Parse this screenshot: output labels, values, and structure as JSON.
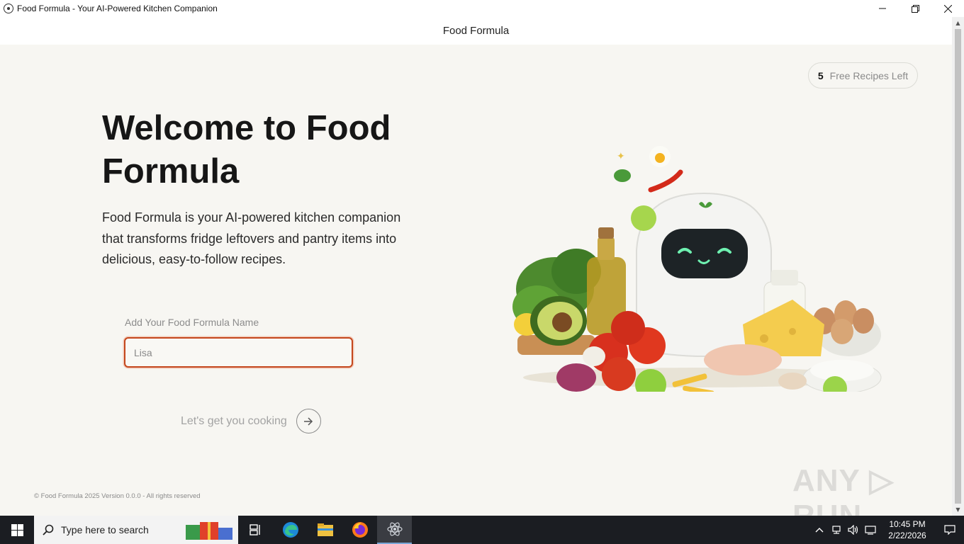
{
  "window": {
    "title": "Food Formula - Your AI-Powered Kitchen Companion",
    "minimize_icon": "minimize-icon",
    "restore_icon": "restore-icon",
    "close_icon": "close-icon"
  },
  "header": {
    "title": "Food Formula"
  },
  "badge": {
    "count": "5",
    "label": "Free Recipes Left"
  },
  "hero": {
    "title": "Welcome to Food Formula",
    "description": "Food Formula is your AI-powered kitchen companion that transforms fridge leftovers and pantry items into delicious, easy-to-follow recipes."
  },
  "form": {
    "name_label": "Add Your Food Formula Name",
    "name_placeholder": "Lisa",
    "name_value": "",
    "submit_label": "Let's get you cooking",
    "submit_icon": "arrow-right-icon"
  },
  "footer": {
    "text": "© Food Formula 2025 Version 0.0.0 - All rights reserved"
  },
  "watermark": {
    "text": "ANY RUN"
  },
  "taskbar": {
    "search_placeholder": "Type here to search",
    "apps": [
      "task-view-icon",
      "edge-icon",
      "file-explorer-icon",
      "firefox-icon",
      "electron-app-icon"
    ],
    "clock_time": "10:45 PM",
    "clock_date": "2/22/2026"
  },
  "colors": {
    "accent_border": "#c4471d",
    "page_background": "#f7f6f2",
    "taskbar": "#1b1d22"
  }
}
